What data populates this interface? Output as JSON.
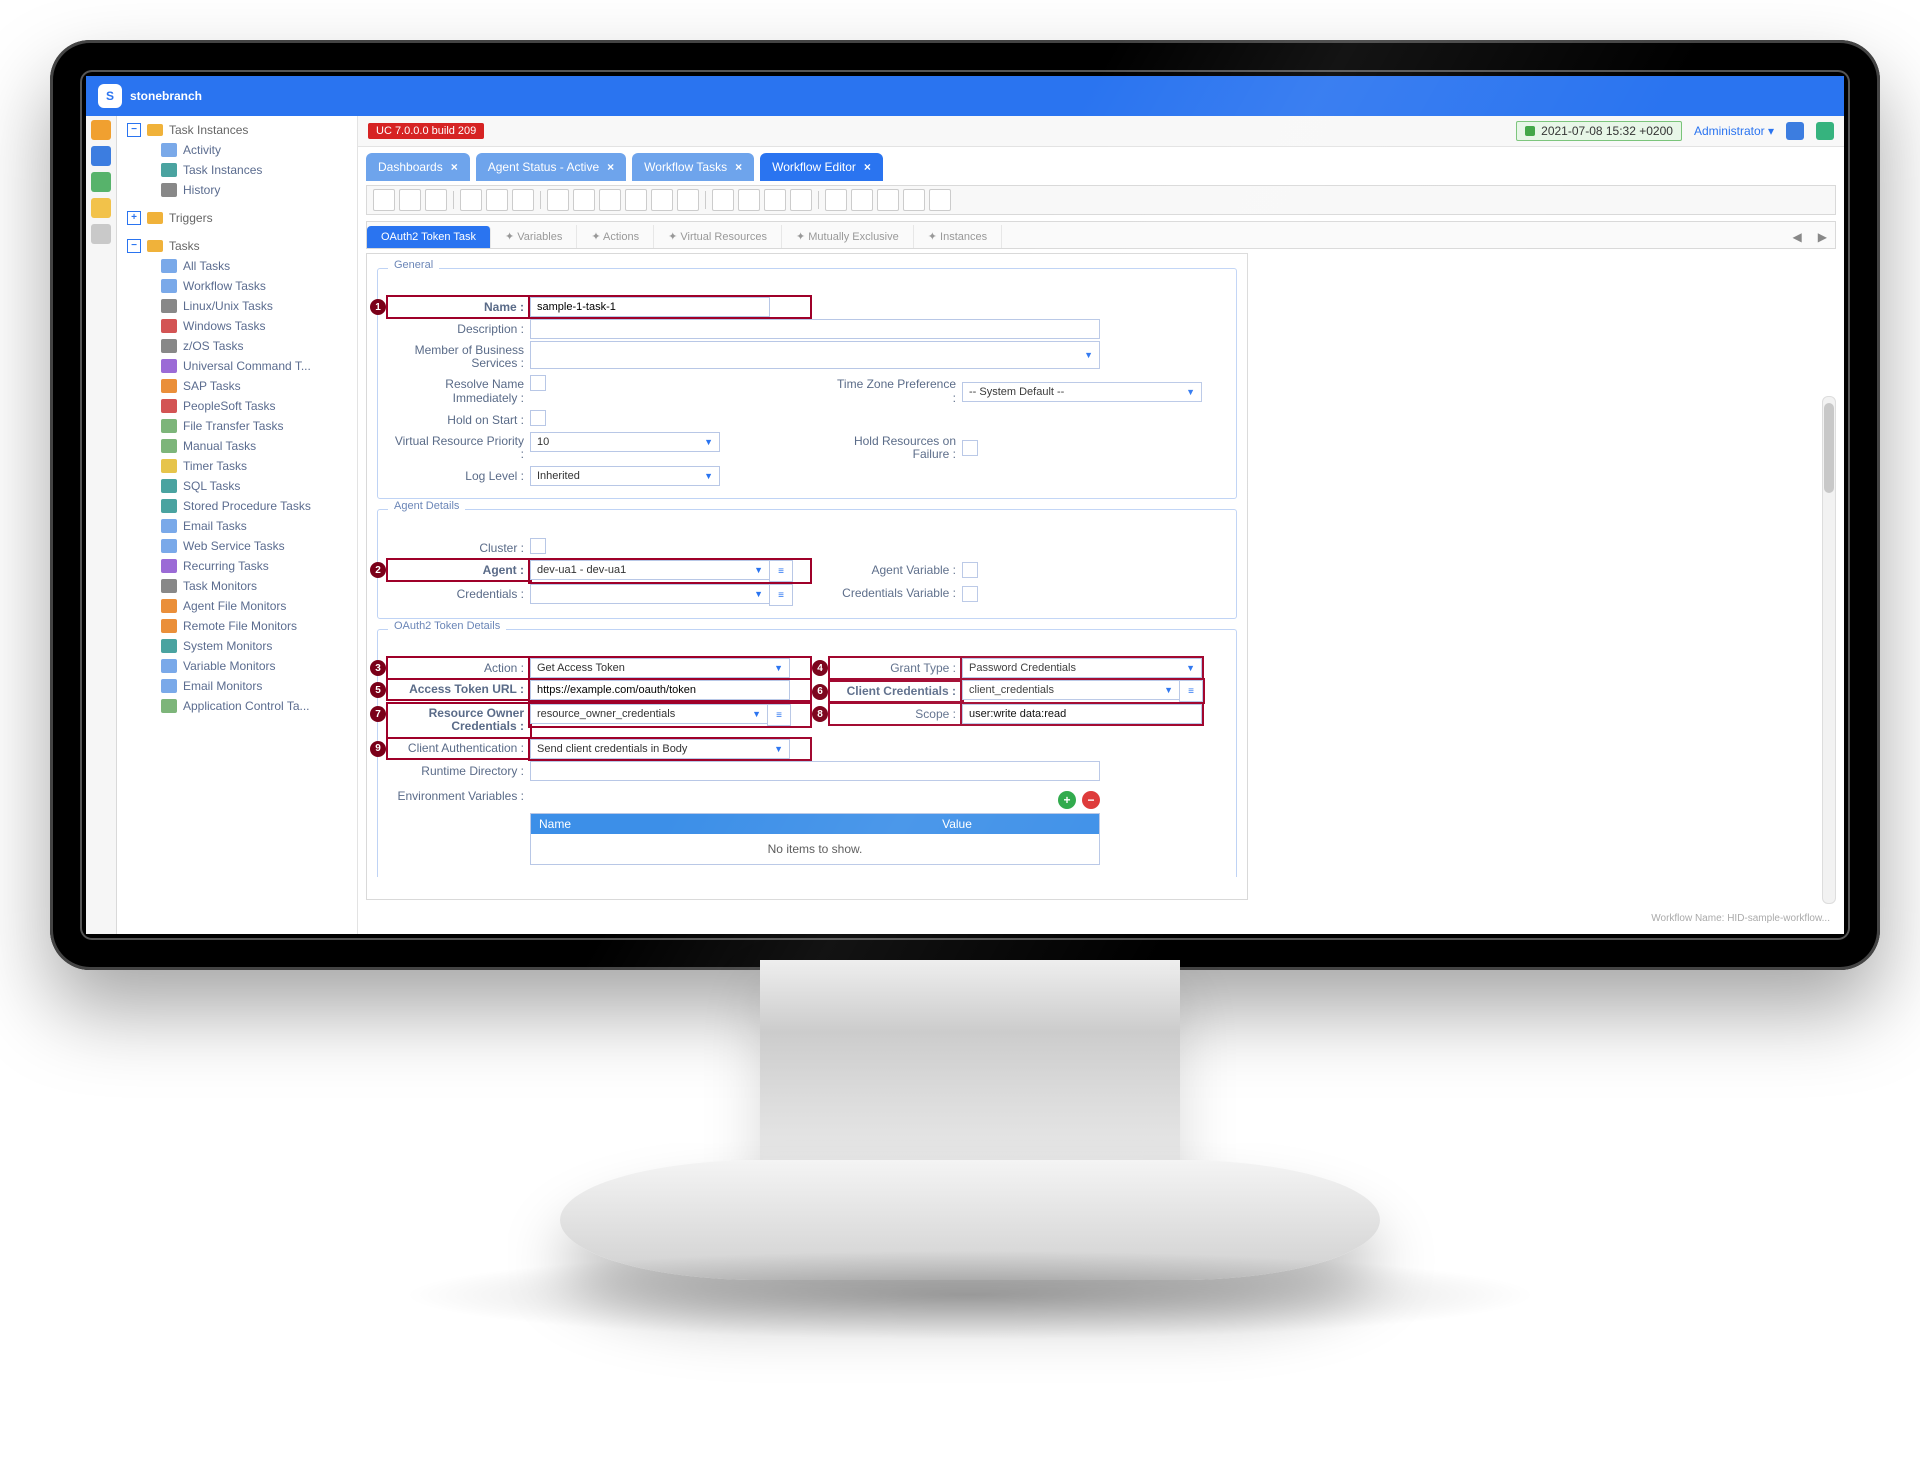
{
  "brand": "stonebranch",
  "build_tag": "UC 7.0.0.0 build 209",
  "clock": "2021-07-08 15:32 +0200",
  "admin_label": "Administrator",
  "nav": {
    "task_instances": {
      "label": "Task Instances",
      "items": [
        "Activity",
        "Task Instances",
        "History"
      ]
    },
    "triggers": {
      "label": "Triggers"
    },
    "tasks": {
      "label": "Tasks",
      "items": [
        "All Tasks",
        "Workflow Tasks",
        "Linux/Unix Tasks",
        "Windows Tasks",
        "z/OS Tasks",
        "Universal Command T...",
        "SAP Tasks",
        "PeopleSoft Tasks",
        "File Transfer Tasks",
        "Manual Tasks",
        "Timer Tasks",
        "SQL Tasks",
        "Stored Procedure Tasks",
        "Email Tasks",
        "Web Service Tasks",
        "Recurring Tasks",
        "Task Monitors",
        "Agent File Monitors",
        "Remote File Monitors",
        "System Monitors",
        "Variable Monitors",
        "Email Monitors",
        "Application Control Ta..."
      ]
    }
  },
  "tabs": [
    "Dashboards",
    "Agent Status - Active",
    "Workflow Tasks",
    "Workflow Editor"
  ],
  "tab_active": 3,
  "subtabs": [
    "OAuth2 Token Task",
    "Variables",
    "Actions",
    "Virtual Resources",
    "Mutually Exclusive",
    "Instances"
  ],
  "subtab_active": 0,
  "form": {
    "general": {
      "legend": "General",
      "name_label": "Name :",
      "name_value": "sample-1-task-1",
      "description_label": "Description :",
      "member_label": "Member of Business Services :",
      "resolve_label": "Resolve Name Immediately :",
      "tz_label": "Time Zone Preference :",
      "tz_value": "-- System Default --",
      "hold_label": "Hold on Start :",
      "vrp_label": "Virtual Resource Priority :",
      "vrp_value": "10",
      "holdres_label": "Hold Resources on Failure :",
      "loglevel_label": "Log Level :",
      "loglevel_value": "Inherited"
    },
    "agent": {
      "legend": "Agent Details",
      "cluster_label": "Cluster :",
      "agent_label": "Agent :",
      "agent_value": "dev-ua1 - dev-ua1",
      "agentvar_label": "Agent Variable :",
      "credentials_label": "Credentials :",
      "credvar_label": "Credentials Variable :"
    },
    "oauth": {
      "legend": "OAuth2 Token Details",
      "action_label": "Action :",
      "action_value": "Get Access Token",
      "grant_label": "Grant Type :",
      "grant_value": "Password Credentials",
      "url_label": "Access Token URL :",
      "url_value": "https://example.com/oauth/token",
      "clientcred_label": "Client Credentials :",
      "clientcred_value": "client_credentials",
      "roc_label": "Resource Owner Credentials :",
      "roc_value": "resource_owner_credentials",
      "scope_label": "Scope :",
      "scope_value": "user:write data:read",
      "clientauth_label": "Client Authentication :",
      "clientauth_value": "Send client credentials in Body",
      "runtime_label": "Runtime Directory :",
      "env_label": "Environment Variables :",
      "env_cols": [
        "Name",
        "Value"
      ],
      "env_empty": "No items to show."
    }
  },
  "footer": "Workflow Name: HID-sample-workflow..."
}
